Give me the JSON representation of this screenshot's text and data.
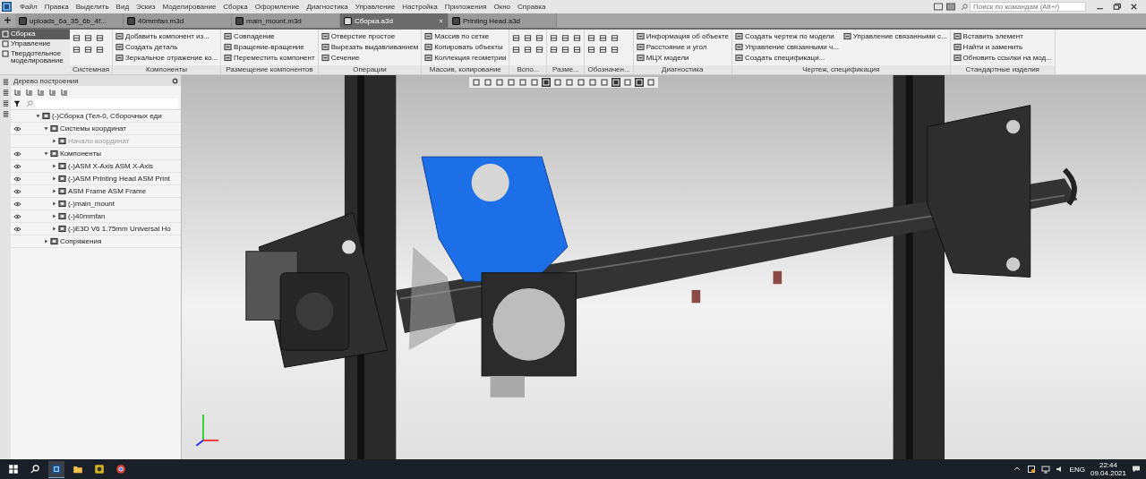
{
  "menu": [
    "Файл",
    "Правка",
    "Выделить",
    "Вид",
    "Эскиз",
    "Моделирование",
    "Сборка",
    "Оформление",
    "Диагностика",
    "Управление",
    "Настройка",
    "Приложения",
    "Окно",
    "Справка"
  ],
  "command_search": {
    "placeholder": "Поиск по командам (Alt+/)"
  },
  "tabs": [
    {
      "label": "uploads_6a_35_6b_4f...",
      "selected": false,
      "closable": false
    },
    {
      "label": "40mmfan.m3d",
      "selected": false,
      "closable": false
    },
    {
      "label": "main_mount.m3d",
      "selected": false,
      "closable": false
    },
    {
      "label": "Сборка.a3d",
      "selected": true,
      "closable": true
    },
    {
      "label": "Printing Head.a3d",
      "selected": false,
      "closable": false
    }
  ],
  "ribbon_sections": [
    {
      "label": "Сборка",
      "selected": true
    },
    {
      "label": "Управление",
      "selected": false
    },
    {
      "label": "Твердотельное моделирование",
      "selected": false
    }
  ],
  "ribbon_groups": [
    {
      "label": "Системная",
      "kind": "icons"
    },
    {
      "label": "Компоненты",
      "kind": "commands",
      "commands": [
        {
          "label": "Добавить компонент из...",
          "disabled": false
        },
        {
          "label": "Создать деталь",
          "disabled": false
        },
        {
          "label": "Зеркальное отражение ко...",
          "disabled": false
        }
      ]
    },
    {
      "label": "Размещение компонентов",
      "kind": "commands",
      "commands": [
        {
          "label": "Совпадение",
          "disabled": false
        },
        {
          "label": "Вращение-вращение",
          "disabled": false
        },
        {
          "label": "Переместить компонент",
          "disabled": false
        }
      ]
    },
    {
      "label": "Операции",
      "kind": "commands",
      "commands": [
        {
          "label": "Отверстие простое",
          "disabled": false
        },
        {
          "label": "Вырезать выдавливанием",
          "disabled": false
        },
        {
          "label": "Сечение",
          "disabled": false
        }
      ]
    },
    {
      "label": "Массив, копирование",
      "kind": "commands",
      "commands": [
        {
          "label": "Массив по сетке",
          "disabled": false
        },
        {
          "label": "Копировать объекты",
          "disabled": false
        },
        {
          "label": "Коллекция геометрии",
          "disabled": false
        }
      ]
    },
    {
      "label": "Вспо...",
      "kind": "icons"
    },
    {
      "label": "Разме...",
      "kind": "icons"
    },
    {
      "label": "Обозначен...",
      "kind": "icons"
    },
    {
      "label": "Диагностика",
      "kind": "commands",
      "commands": [
        {
          "label": "Информация об объекте",
          "disabled": false
        },
        {
          "label": "Расстояние и угол",
          "disabled": false
        },
        {
          "label": "МЦХ модели",
          "disabled": false
        }
      ]
    },
    {
      "label": "Чертеж, спецификация",
      "kind": "commands",
      "commands": [
        {
          "label": "Создать чертеж по модели",
          "disabled": false
        },
        {
          "label": "Управление связанными ч...",
          "disabled": false
        },
        {
          "label": "Создать спецификаци...",
          "disabled": false
        },
        {
          "label": "Управление связанными с...",
          "disabled": false
        }
      ]
    },
    {
      "label": "Стандартные изделия",
      "kind": "commands",
      "commands": [
        {
          "label": "Вставить элемент",
          "disabled": false
        },
        {
          "label": "Найти и заменить",
          "disabled": false
        },
        {
          "label": "Обновить ссылки на мод...",
          "disabled": false
        }
      ]
    }
  ],
  "tree_panel": {
    "title": "Дерево построения",
    "items": [
      {
        "label": "(-)Сборка (Тел-0, Сборочных еди",
        "visible": false,
        "expanded": true,
        "dimmed": false,
        "children": [
          {
            "label": "Системы координат",
            "visible": true,
            "expanded": true,
            "dimmed": false,
            "children": [
              {
                "label": "Начало координат",
                "visible": false,
                "expanded": false,
                "dimmed": true
              }
            ]
          },
          {
            "label": "Компоненты",
            "visible": true,
            "expanded": true,
            "dimmed": false,
            "children": [
              {
                "label": "(-)ASM X-Axis ASM X-Axis",
                "visible": true,
                "expanded": false,
                "dimmed": false
              },
              {
                "label": "(-)ASM Printing Head ASM Print",
                "visible": true,
                "expanded": false,
                "dimmed": false
              },
              {
                "label": "ASM Frame ASM Frame",
                "visible": true,
                "expanded": false,
                "dimmed": false
              },
              {
                "label": "(-)main_mount",
                "visible": true,
                "expanded": false,
                "dimmed": false
              },
              {
                "label": "(-)40mmfan",
                "visible": true,
                "expanded": false,
                "dimmed": false
              },
              {
                "label": "(-)E3D V6 1.75mm Universal Ho",
                "visible": true,
                "expanded": false,
                "dimmed": false
              }
            ]
          },
          {
            "label": "Сопряжения",
            "visible": false,
            "expanded": false,
            "dimmed": false
          }
        ]
      }
    ]
  },
  "taskbar": {
    "language": "ENG",
    "time": "22:44",
    "date": "09.04.2021"
  }
}
